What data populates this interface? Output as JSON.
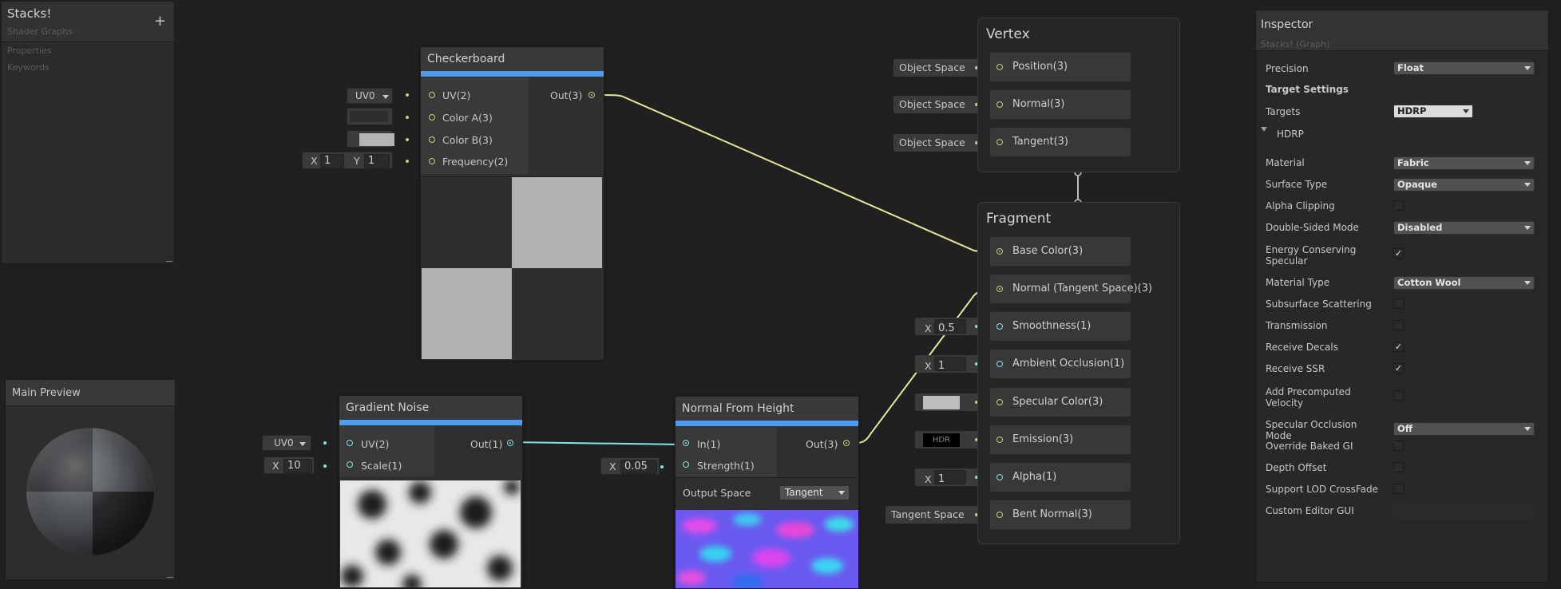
{
  "blackboard": {
    "title": "Stacks!",
    "subtitle": "Shader Graphs",
    "add_label": "+",
    "sections": [
      "Properties",
      "Keywords"
    ]
  },
  "preview": {
    "title": "Main Preview"
  },
  "checkerboard": {
    "title": "Checkerboard",
    "inputs": [
      "UV(2)",
      "Color A(3)",
      "Color B(3)",
      "Frequency(2)"
    ],
    "output": "Out(3)",
    "uv_dropdown": "UV0",
    "freq_x_label": "X",
    "freq_x": "1",
    "freq_y_label": "Y",
    "freq_y": "1",
    "color_a": "#2e2e2e",
    "color_b": "#b4b4b4"
  },
  "gradient_noise": {
    "title": "Gradient Noise",
    "inputs": [
      "UV(2)",
      "Scale(1)"
    ],
    "output": "Out(1)",
    "uv_dropdown": "UV0",
    "scale_label": "X",
    "scale": "10"
  },
  "normal_from_height": {
    "title": "Normal From Height",
    "inputs": [
      "In(1)",
      "Strength(1)"
    ],
    "output": "Out(3)",
    "strength_label": "X",
    "strength": "0.05",
    "output_space_label": "Output Space",
    "output_space_value": "Tangent"
  },
  "vertex": {
    "title": "Vertex",
    "blocks": [
      {
        "label": "Position(3)",
        "prop": "Object Space"
      },
      {
        "label": "Normal(3)",
        "prop": "Object Space"
      },
      {
        "label": "Tangent(3)",
        "prop": "Object Space"
      }
    ]
  },
  "fragment": {
    "title": "Fragment",
    "blocks": [
      {
        "label": "Base Color(3)"
      },
      {
        "label": "Normal (Tangent Space)(3)"
      },
      {
        "label": "Smoothness(1)",
        "axis": "X",
        "value": "0.5"
      },
      {
        "label": "Ambient Occlusion(1)",
        "axis": "X",
        "value": "1"
      },
      {
        "label": "Specular Color(3)",
        "swatch": "#bdbdbd"
      },
      {
        "label": "Emission(3)",
        "value": "HDR"
      },
      {
        "label": "Alpha(1)",
        "axis": "X",
        "value": "1"
      },
      {
        "label": "Bent Normal(3)",
        "prop": "Tangent Space"
      }
    ]
  },
  "inspector": {
    "title": "Inspector",
    "subtitle": "Stacks! (Graph)",
    "precision_label": "Precision",
    "precision_value": "Float",
    "target_settings": "Target Settings",
    "targets_label": "Targets",
    "targets_value": "HDRP",
    "hdrp_label": "HDRP",
    "rows": [
      {
        "label": "Material",
        "value": "Fabric"
      },
      {
        "label": "Surface Type",
        "value": "Opaque"
      },
      {
        "label": "Alpha Clipping",
        "checked": false
      },
      {
        "label": "Double-Sided Mode",
        "value": "Disabled"
      },
      {
        "label": "Energy Conserving Specular",
        "checked": true
      },
      {
        "label": "Material Type",
        "value": "Cotton Wool"
      },
      {
        "label": "Subsurface Scattering",
        "checked": false
      },
      {
        "label": "Transmission",
        "checked": false
      },
      {
        "label": "Receive Decals",
        "checked": true
      },
      {
        "label": "Receive SSR",
        "checked": true
      },
      {
        "label": "Add Precomputed Velocity",
        "checked": false
      },
      {
        "label": "Specular Occlusion Mode",
        "value": "Off"
      },
      {
        "label": "Override Baked GI",
        "checked": false
      },
      {
        "label": "Depth Offset",
        "checked": false
      },
      {
        "label": "Support LOD CrossFade",
        "checked": false
      },
      {
        "label": "Custom Editor GUI",
        "value": ""
      }
    ],
    "check_mark": "✓"
  },
  "colors": {
    "wire_yellow": "#e7e69a",
    "wire_cyan": "#84e4e7",
    "accent_blue": "#4e9cf0"
  }
}
